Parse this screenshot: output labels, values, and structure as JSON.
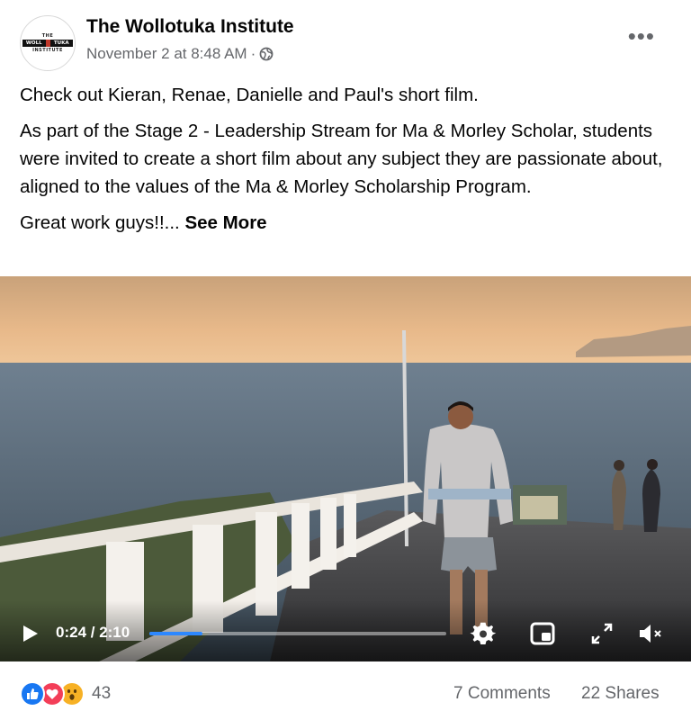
{
  "post": {
    "page_name": "The Wollotuka Institute",
    "timestamp": "November 2 at 8:48 AM",
    "separator": "·",
    "privacy_icon": "globe-icon",
    "more_icon": "•••",
    "logo": {
      "top": "THE",
      "left": "WOLL",
      "right": "TUKA",
      "bottom": "INSTITUTE"
    },
    "paragraphs": [
      "Check out Kieran, Renae, Danielle and Paul's short film.",
      "As part of the Stage 2 - Leadership Stream for Ma & Morley Scholar, students were invited to create a short film about any subject they are passionate about, aligned to the values of the Ma & Morley Scholarship Program."
    ],
    "last_line": "Great work guys!!...",
    "see_more": "See More"
  },
  "video": {
    "current_time": "0:24",
    "duration": "2:10",
    "time_display": "0:24 / 2:10",
    "progress": 0.18,
    "buffered": 0.78,
    "icons": [
      "play-icon",
      "settings-icon",
      "picture-in-picture-icon",
      "fullscreen-icon",
      "mute-icon"
    ]
  },
  "engagement": {
    "reaction_icons": [
      "like-icon",
      "love-icon",
      "wow-icon"
    ],
    "reaction_count": "43",
    "comments": "7 Comments",
    "shares": "22 Shares"
  },
  "colors": {
    "accent": "#2d88ff",
    "like": "#1877f2",
    "love": "#f33e58",
    "wow": "#f7b125",
    "secondary_text": "#65676b"
  }
}
